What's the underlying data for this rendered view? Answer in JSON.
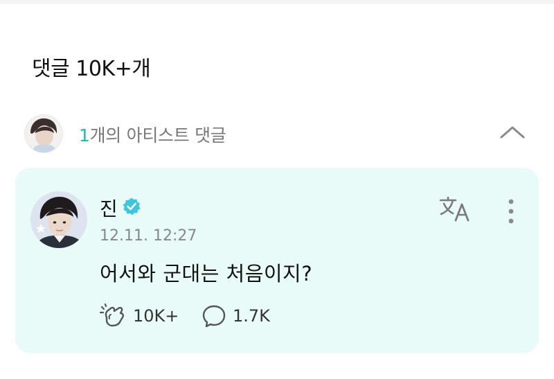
{
  "comments_header": "댓글 10K+개",
  "artist_comments": {
    "count": "1",
    "label": "개의 아티스트 댓글"
  },
  "comment": {
    "author": "진",
    "timestamp": "12.11. 12:27",
    "body": "어서와 군대는 처음이지?",
    "likes": "10K+",
    "replies": "1.7K"
  },
  "icons": {
    "collapse": "chevron-up-icon",
    "verified": "verified-badge-icon",
    "translate": "translate-icon",
    "more": "more-vertical-icon",
    "like": "cheer-hand-icon",
    "reply": "speech-bubble-icon"
  },
  "colors": {
    "accent": "#1fb9b0",
    "card_background": "#e8fbf8",
    "verified": "#3ec7dc"
  }
}
